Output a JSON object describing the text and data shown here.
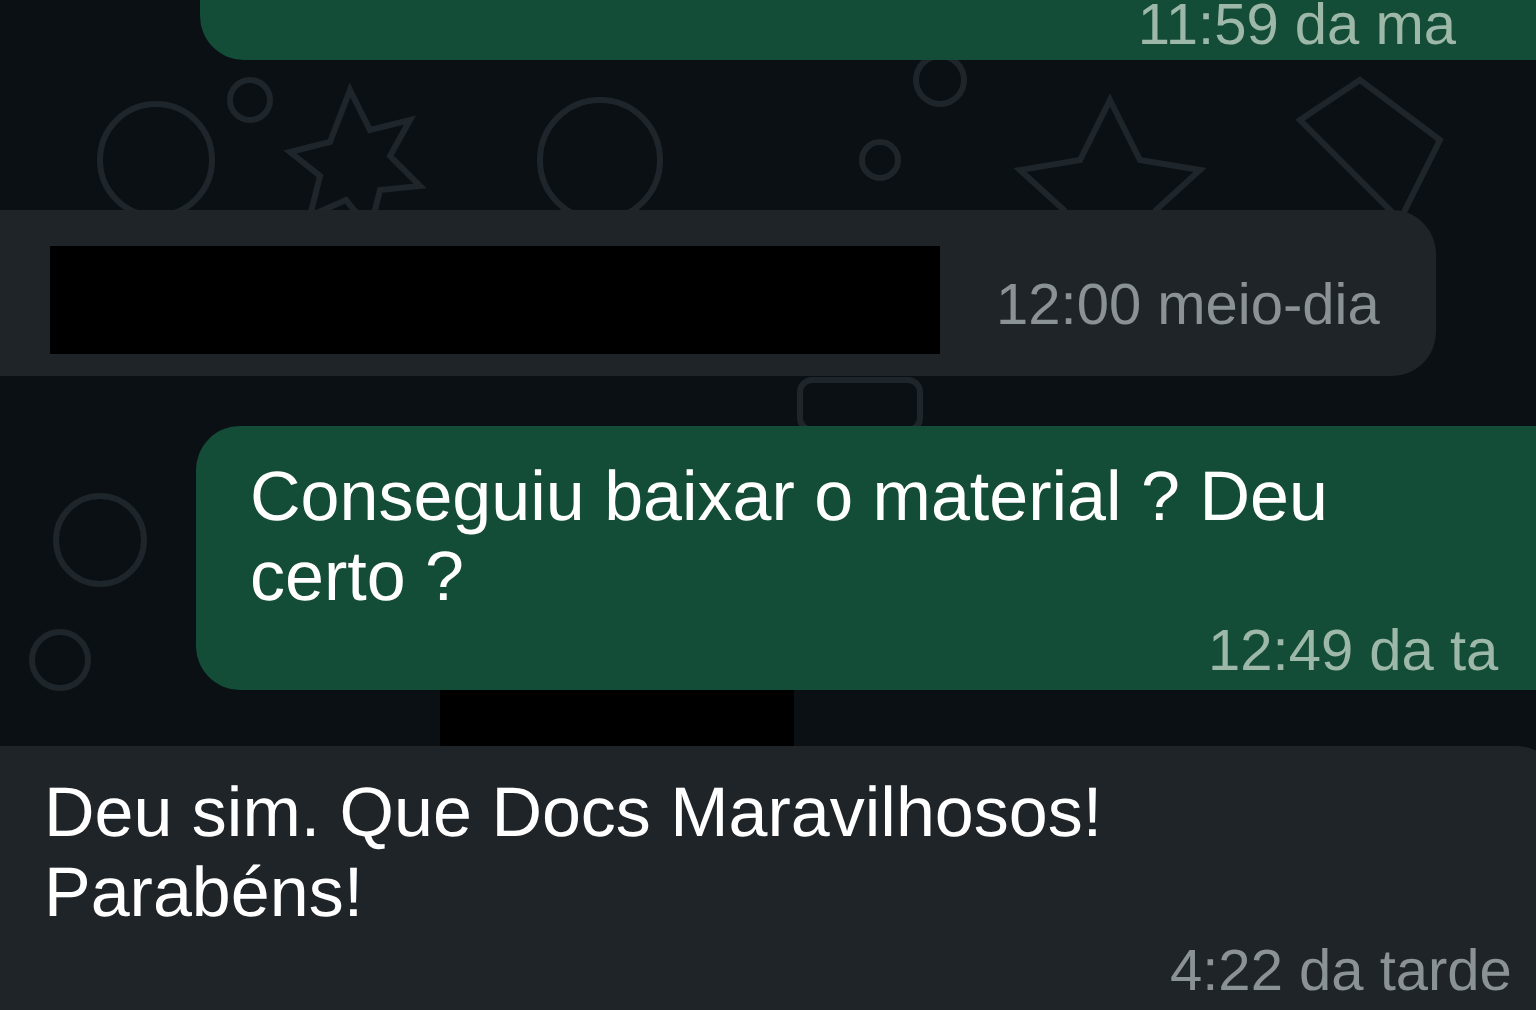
{
  "messages": [
    {
      "kind": "outgoing",
      "time": "11:59 da ma",
      "redacted": false
    },
    {
      "kind": "incoming",
      "time": "12:00 meio-dia",
      "redacted": true
    },
    {
      "kind": "outgoing",
      "text": "Conseguiu baixar o material ? Deu certo ?",
      "time": "12:49 da ta",
      "redacted": false
    },
    {
      "kind": "redaction"
    },
    {
      "kind": "incoming",
      "text": "Deu sim. Que Docs Maravilhosos! Parabéns!",
      "time": "4:22 da tarde",
      "redacted": false
    }
  ]
}
